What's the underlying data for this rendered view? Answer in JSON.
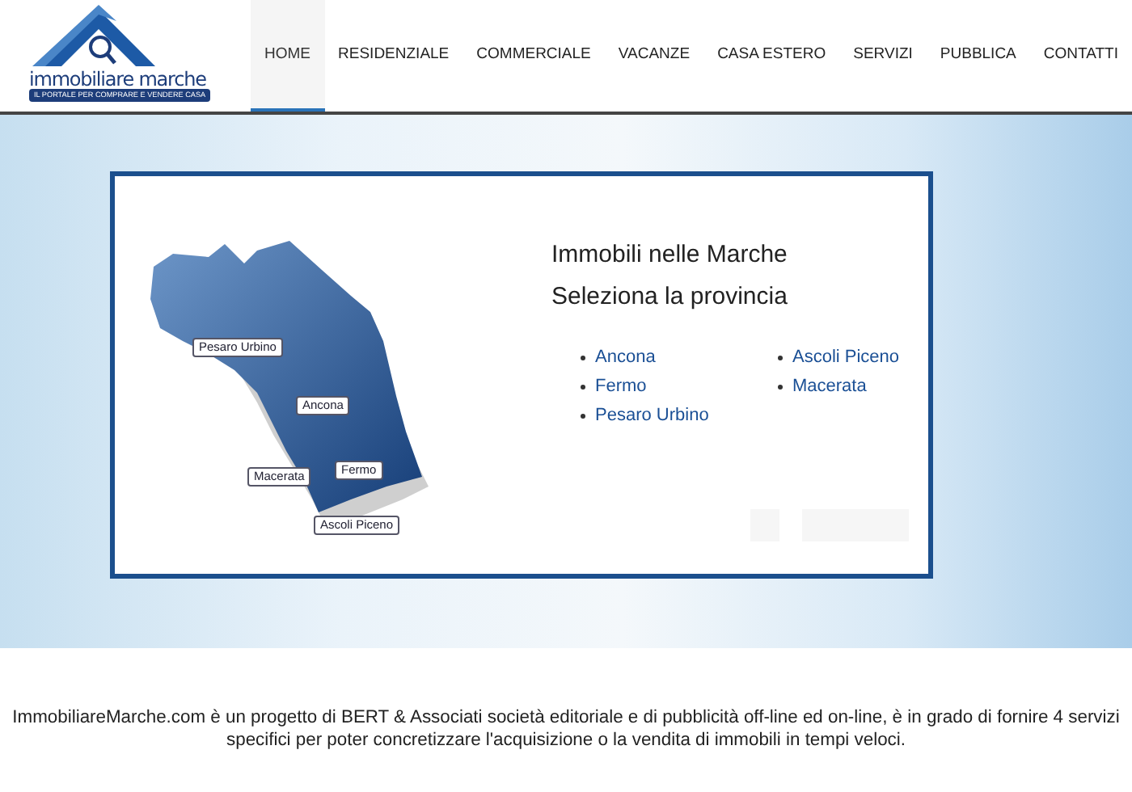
{
  "logo": {
    "name": "immobiliare marche",
    "tagline": "IL PORTALE PER COMPRARE E VENDERE CASA"
  },
  "nav": [
    {
      "label": "HOME",
      "selected": true
    },
    {
      "label": "RESIDENZIALE",
      "selected": false
    },
    {
      "label": "COMMERCIALE",
      "selected": false
    },
    {
      "label": "VACANZE",
      "selected": false
    },
    {
      "label": "CASA ESTERO",
      "selected": false
    },
    {
      "label": "SERVIZI",
      "selected": false
    },
    {
      "label": "PUBBLICA",
      "selected": false
    },
    {
      "label": "CONTATTI",
      "selected": false
    }
  ],
  "map": {
    "labels": [
      "Pesaro Urbino",
      "Ancona",
      "Fermo",
      "Macerata",
      "Ascoli Piceno"
    ]
  },
  "panel": {
    "title": "Immobili nelle Marche",
    "subtitle": "Seleziona la provincia",
    "provinces": [
      [
        "Ancona",
        "Fermo",
        "Pesaro Urbino"
      ],
      [
        "Ascoli Piceno",
        "Macerata"
      ]
    ]
  },
  "intro": "ImmobiliareMarche.com è un progetto di BERT & Associati società editoriale e di pubblicità off-line ed on-line, è in grado di fornire 4 servizi specifici per poter concretizzare l'acquisizione o la vendita di immobili in tempi veloci."
}
